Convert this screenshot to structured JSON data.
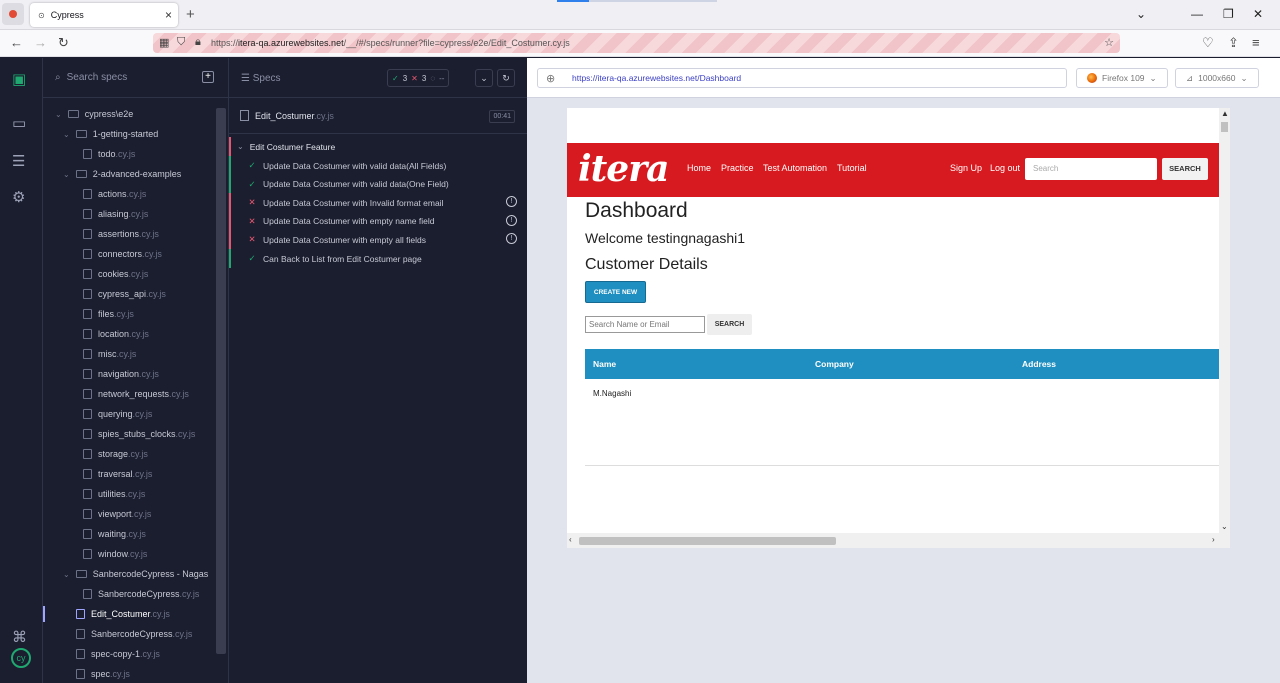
{
  "browser": {
    "tab_title": "Cypress",
    "url_prefix": "https://",
    "url_host": "itera-qa.azurewebsites.net",
    "url_rest": "/__/#/specs/runner?file=cypress/e2e/Edit_Costumer.cy.js"
  },
  "files": {
    "search_placeholder": "Search specs",
    "root": "cypress\\e2e",
    "folders": [
      {
        "name": "1-getting-started",
        "files": [
          {
            "name": "todo",
            "ext": ".cy.js"
          }
        ]
      },
      {
        "name": "2-advanced-examples",
        "files": [
          {
            "name": "actions",
            "ext": ".cy.js"
          },
          {
            "name": "aliasing",
            "ext": ".cy.js"
          },
          {
            "name": "assertions",
            "ext": ".cy.js"
          },
          {
            "name": "connectors",
            "ext": ".cy.js"
          },
          {
            "name": "cookies",
            "ext": ".cy.js"
          },
          {
            "name": "cypress_api",
            "ext": ".cy.js"
          },
          {
            "name": "files",
            "ext": ".cy.js"
          },
          {
            "name": "location",
            "ext": ".cy.js"
          },
          {
            "name": "misc",
            "ext": ".cy.js"
          },
          {
            "name": "navigation",
            "ext": ".cy.js"
          },
          {
            "name": "network_requests",
            "ext": ".cy.js"
          },
          {
            "name": "querying",
            "ext": ".cy.js"
          },
          {
            "name": "spies_stubs_clocks",
            "ext": ".cy.js"
          },
          {
            "name": "storage",
            "ext": ".cy.js"
          },
          {
            "name": "traversal",
            "ext": ".cy.js"
          },
          {
            "name": "utilities",
            "ext": ".cy.js"
          },
          {
            "name": "viewport",
            "ext": ".cy.js"
          },
          {
            "name": "waiting",
            "ext": ".cy.js"
          },
          {
            "name": "window",
            "ext": ".cy.js"
          }
        ]
      },
      {
        "name": "SanbercodeCypress - Nagas",
        "files": [
          {
            "name": "SanbercodeCypress",
            "ext": ".cy.js"
          }
        ]
      }
    ],
    "root_files": [
      {
        "name": "Edit_Costumer",
        "ext": ".cy.js",
        "active": true
      },
      {
        "name": "SanbercodeCypress",
        "ext": ".cy.js"
      },
      {
        "name": "spec-copy-1",
        "ext": ".cy.js"
      },
      {
        "name": "spec",
        "ext": ".cy.js"
      }
    ]
  },
  "runner": {
    "title": "Specs",
    "passed": "3",
    "failed": "3",
    "pending": "--",
    "spec_name": "Edit_Costumer",
    "spec_ext": ".cy.js",
    "duration": "00:41",
    "suite": "Edit Costumer Feature",
    "tests": [
      {
        "status": "pass",
        "title": "Update Data Costumer with valid data(All Fields)"
      },
      {
        "status": "pass",
        "title": "Update Data Costumer with valid data(One Field)"
      },
      {
        "status": "fail",
        "title": "Update Data Costumer with Invalid format email"
      },
      {
        "status": "fail",
        "title": "Update Data Costumer with empty name field"
      },
      {
        "status": "fail",
        "title": "Update Data Costumer with empty all fields"
      },
      {
        "status": "pass",
        "title": "Can Back to List from Edit Costumer page"
      }
    ]
  },
  "aut": {
    "url": "https://itera-qa.azurewebsites.net/Dashboard",
    "browser_label": "Firefox 109",
    "viewport_label": "1000x660"
  },
  "site": {
    "logo": "itera",
    "nav": [
      "Home",
      "Practice",
      "Test Automation",
      "Tutorial"
    ],
    "sign_up": "Sign Up",
    "log_out": "Log out",
    "search_placeholder": "Search",
    "search_btn": "SEARCH",
    "heading": "Dashboard",
    "welcome": "Welcome testingnagashi1",
    "details": "Customer Details",
    "create_btn": "CREATE NEW",
    "filter_placeholder": "Search Name or Email",
    "filter_btn": "SEARCH",
    "columns": [
      "Name",
      "Company",
      "Address"
    ],
    "rows": [
      [
        "M.Nagashi",
        "",
        ""
      ]
    ]
  }
}
